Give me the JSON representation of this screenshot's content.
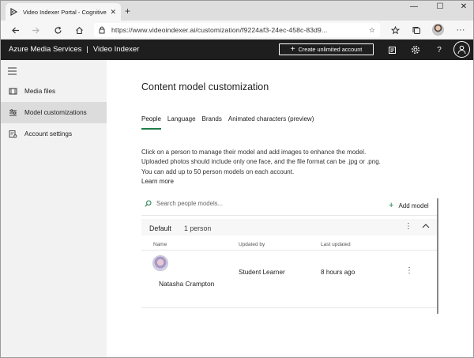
{
  "browser": {
    "tab_title": "Video Indexer Portal - Cognitive",
    "tab_close": "✕",
    "new_tab": "+",
    "window_controls": [
      "—",
      "☐",
      "✕"
    ],
    "url": "https://www.videoindexer.ai/customization/f9224af3-24ec-458c-83d9..."
  },
  "header": {
    "brand_left": "Azure Media Services",
    "brand_sep": "|",
    "brand_right": "Video Indexer",
    "cta": "Create unlimited account"
  },
  "sidebar": {
    "items": [
      {
        "label": "Media files"
      },
      {
        "label": "Model customizations"
      },
      {
        "label": "Account settings"
      }
    ]
  },
  "main": {
    "title": "Content model customization",
    "tabs": [
      {
        "label": "People"
      },
      {
        "label": "Language"
      },
      {
        "label": "Brands"
      },
      {
        "label": "Animated characters (preview)"
      }
    ],
    "description": [
      "Click on a person to manage their model and add images to enhance the model.",
      "Uploaded photos should include only one face, and the file format can be .jpg or .png.",
      "You can add up to 50 person models on each account."
    ],
    "learn_more": "Learn more",
    "search_placeholder": "Search people models...",
    "add_model": "Add model",
    "group": {
      "name": "Default",
      "count": "1 person"
    },
    "columns": {
      "name": "Name",
      "updated_by": "Updated by",
      "last_updated": "Last updated"
    },
    "rows": [
      {
        "name": "Natasha Crampton",
        "updated_by": "Student Learner",
        "last_updated": "8 hours ago"
      }
    ]
  },
  "colors": {
    "header_bg": "#1e1e1e",
    "accent": "#1e7e4a",
    "sidebar_bg": "#f2f2f2"
  }
}
